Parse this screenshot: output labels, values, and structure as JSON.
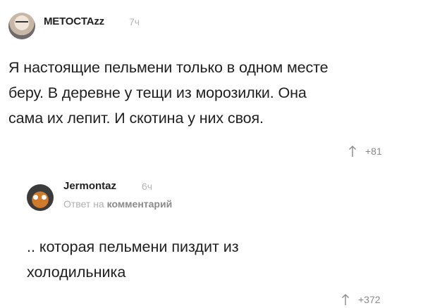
{
  "comment": {
    "author": "METOCTAzz",
    "time": "7ч",
    "body_lines": [
      "Я настоящие пельмени только в одном месте",
      "беру. В деревне у тещи из морозилки. Она",
      "сама их лепит. И скотина у них своя."
    ],
    "rating": "+81"
  },
  "reply": {
    "author": "Jermontaz",
    "time": "6ч",
    "reply_prefix": "Ответ на",
    "reply_link": "комментарий",
    "body_lines": [
      ".. которая пельмени пиздит из",
      "холодильника"
    ],
    "rating": "+372"
  },
  "icons": {
    "upvote": "arrow-up-icon",
    "avatar_1": "avatar-glasses-man",
    "avatar_2": "avatar-cartoon-cat"
  },
  "colors": {
    "author": "#222222",
    "time": "#b5b5b5",
    "body": "#1f1f1f",
    "rating": "#8a8a8a"
  }
}
